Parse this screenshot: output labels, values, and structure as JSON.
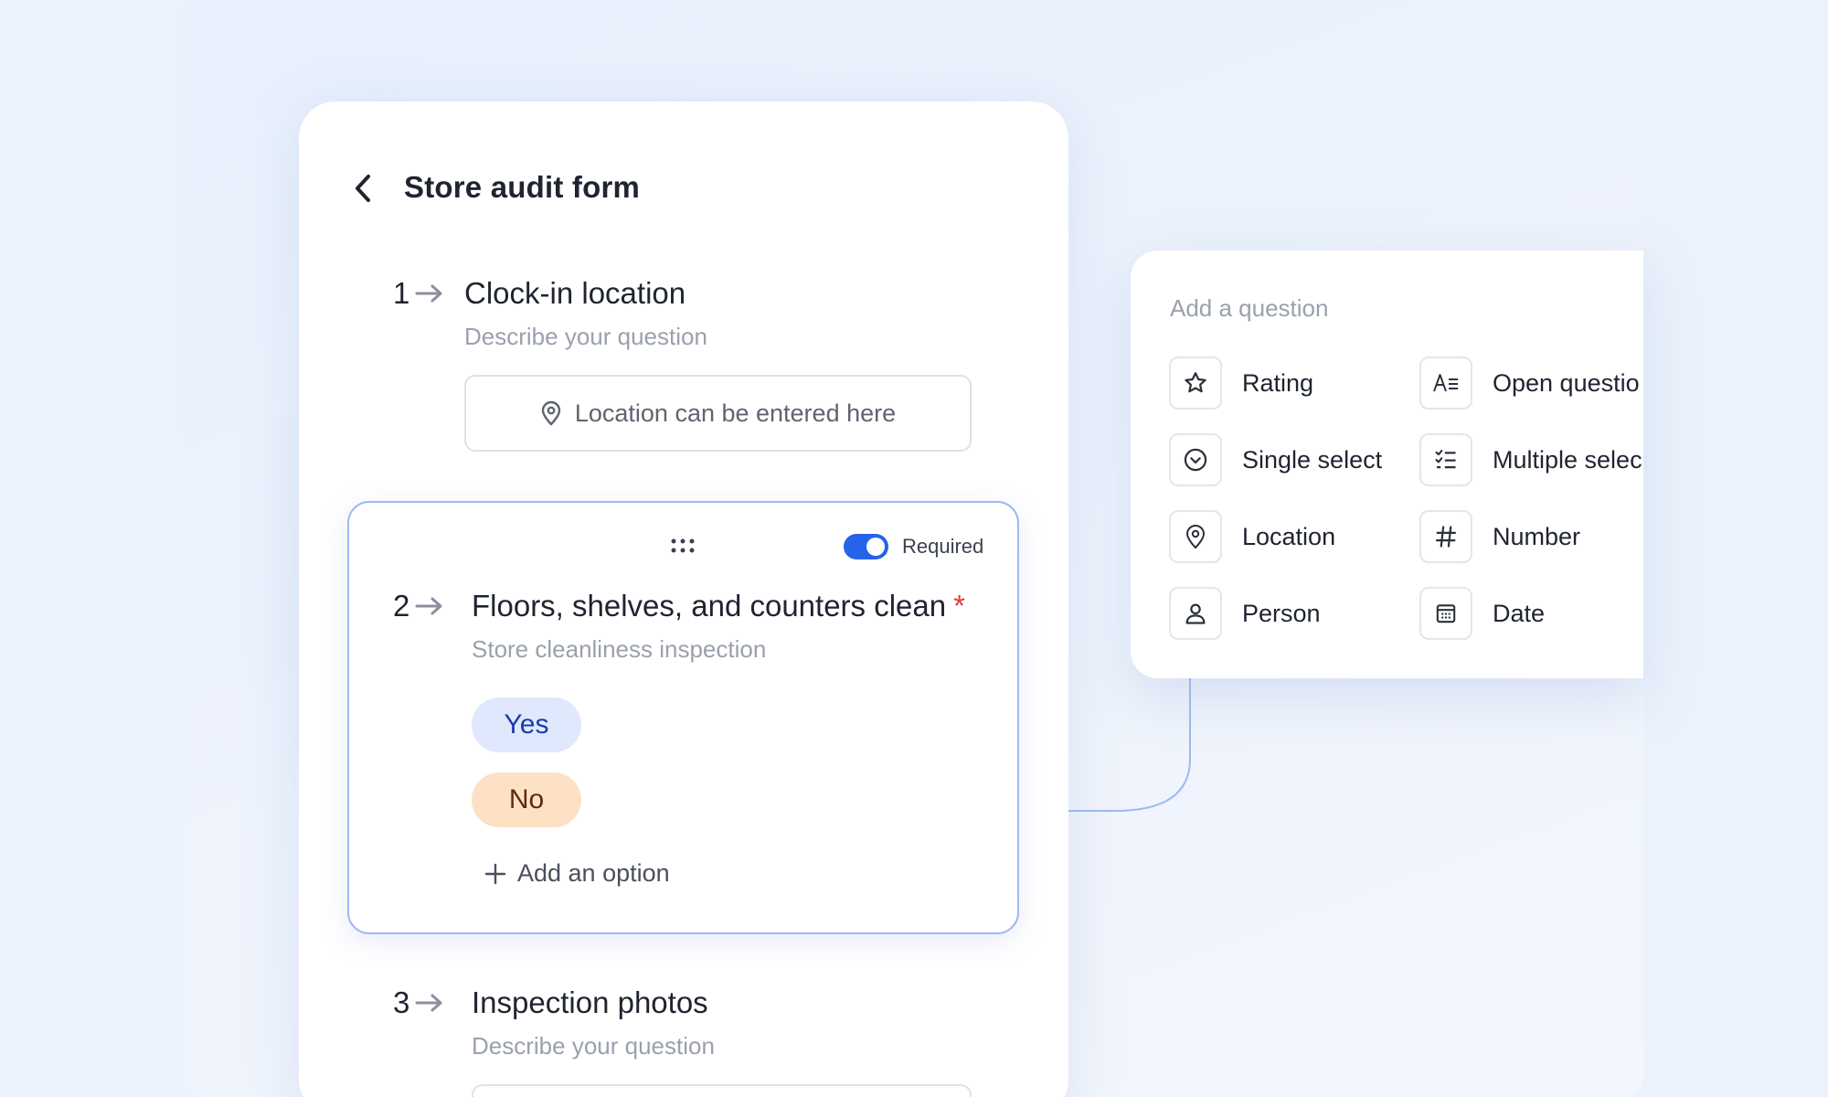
{
  "form": {
    "title": "Store audit form"
  },
  "questions": [
    {
      "number": "1",
      "title": "Clock-in location",
      "description": "Describe your question",
      "input_placeholder": "Location can be entered here"
    },
    {
      "number": "2",
      "title": "Floors, shelves, and counters clean",
      "required_mark": "*",
      "description": "Store cleanliness inspection",
      "required_label": "Required",
      "required_on": true,
      "options": [
        "Yes",
        "No"
      ],
      "add_option_label": "Add an option"
    },
    {
      "number": "3",
      "title": "Inspection photos",
      "description": "Describe your question"
    }
  ],
  "add_question": {
    "title": "Add a question",
    "types": [
      {
        "label": "Rating",
        "icon": "star-icon"
      },
      {
        "label": "Open questio",
        "icon": "text-icon"
      },
      {
        "label": "Single select",
        "icon": "chevron-circle-icon"
      },
      {
        "label": "Multiple selec",
        "icon": "checklist-icon"
      },
      {
        "label": "Location",
        "icon": "location-pin-icon"
      },
      {
        "label": "Number",
        "icon": "hash-icon"
      },
      {
        "label": "Person",
        "icon": "person-icon"
      },
      {
        "label": "Date",
        "icon": "calendar-icon"
      }
    ]
  },
  "colors": {
    "accent": "#2563eb",
    "selected_border": "#9cbaf5",
    "yes_chip": "#dfe8fc",
    "no_chip": "#fde1c4",
    "required_star": "#e53935"
  }
}
